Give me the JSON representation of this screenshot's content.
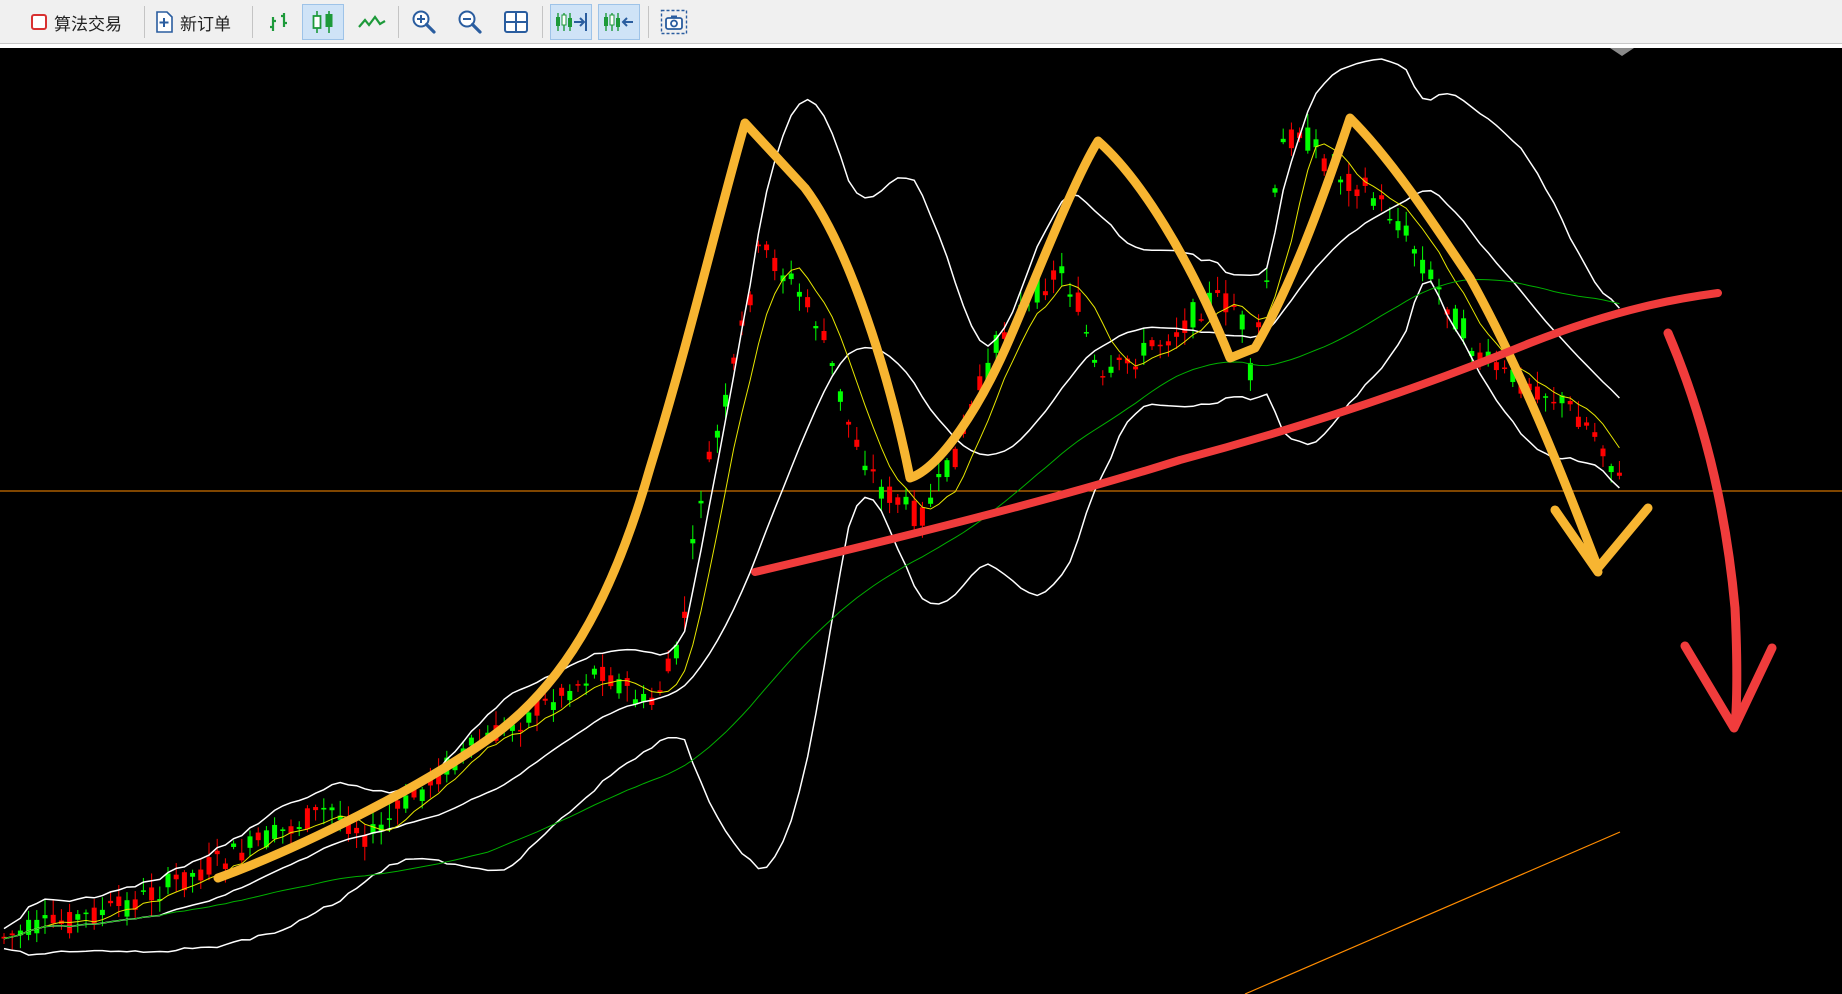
{
  "toolbar": {
    "algo_trading": {
      "label": "算法交易",
      "icon": "algo-trading-icon",
      "color": "#d83030"
    },
    "new_order": {
      "label": "新订单",
      "icon": "new-order-icon"
    },
    "tools": [
      {
        "icon": "bar-chart-icon",
        "active": false
      },
      {
        "icon": "candlestick-chart-icon",
        "active": true
      },
      {
        "icon": "line-chart-icon",
        "active": false
      },
      {
        "icon": "zoom-in-icon",
        "active": false
      },
      {
        "icon": "zoom-out-icon",
        "active": false
      },
      {
        "icon": "tile-windows-icon",
        "active": false
      },
      {
        "icon": "auto-scroll-icon",
        "active": true
      },
      {
        "icon": "chart-shift-icon",
        "active": true
      },
      {
        "icon": "screenshot-icon",
        "active": false
      }
    ]
  },
  "chart": {
    "type": "candlestick",
    "background": "#000000",
    "bull_color": "#00ff00",
    "bear_color": "#ff0000",
    "price_line_color": "#ff8c00",
    "indicators": [
      {
        "name": "bollinger-bands",
        "color": "#ffffff"
      },
      {
        "name": "fast-moving-average",
        "color": "#e6e600"
      },
      {
        "name": "slow-moving-average",
        "color": "#00b000"
      },
      {
        "name": "long-moving-average",
        "color": "#ff8c00"
      }
    ],
    "annotations": [
      {
        "name": "triple-top-pattern",
        "color": "#f7b531"
      },
      {
        "name": "neckline",
        "color": "#f03c3c"
      },
      {
        "name": "down-arrow",
        "color": "#f03c3c"
      }
    ]
  }
}
